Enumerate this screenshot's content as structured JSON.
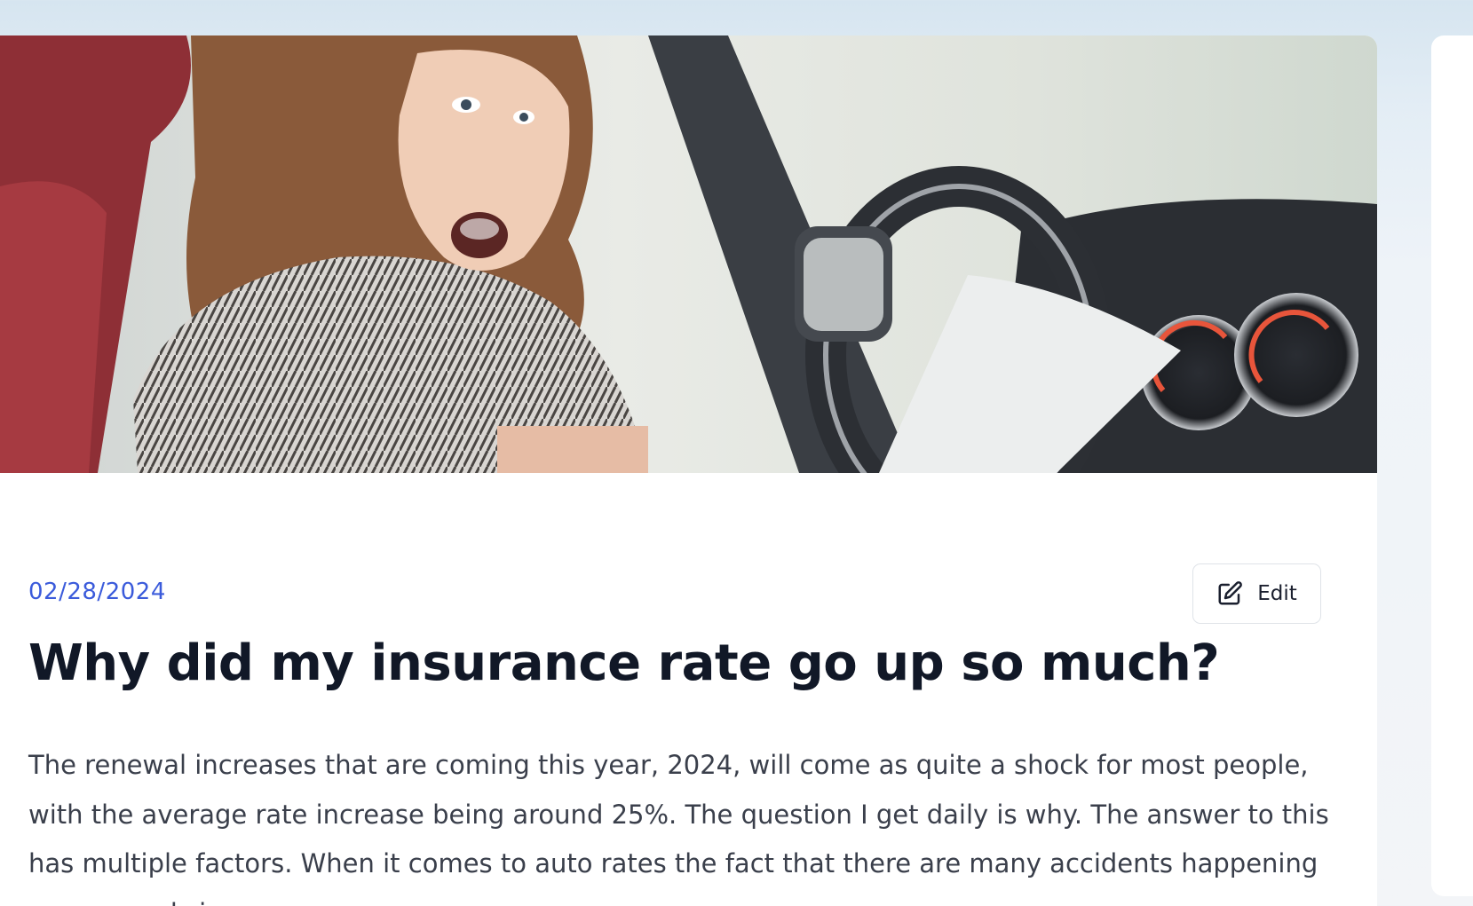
{
  "article": {
    "hero_image_alt": "Shocked woman in a car reading a paper",
    "date": "02/28/2024",
    "edit_label": "Edit",
    "title": "Why did my insurance rate go up so much?",
    "body": "The renewal increases that are coming this year, 2024, will come as quite a shock for most people, with the average rate increase being around 25%. The question I get daily is why. The answer to this has multiple factors. When it comes to auto rates the fact that there are many accidents happening on our roads is one reason."
  },
  "icons": {
    "edit": "edit-icon"
  },
  "colors": {
    "accent": "#3b5bdb",
    "title": "#111827",
    "body": "#3a3f4b",
    "background": "#d6e5f0"
  }
}
